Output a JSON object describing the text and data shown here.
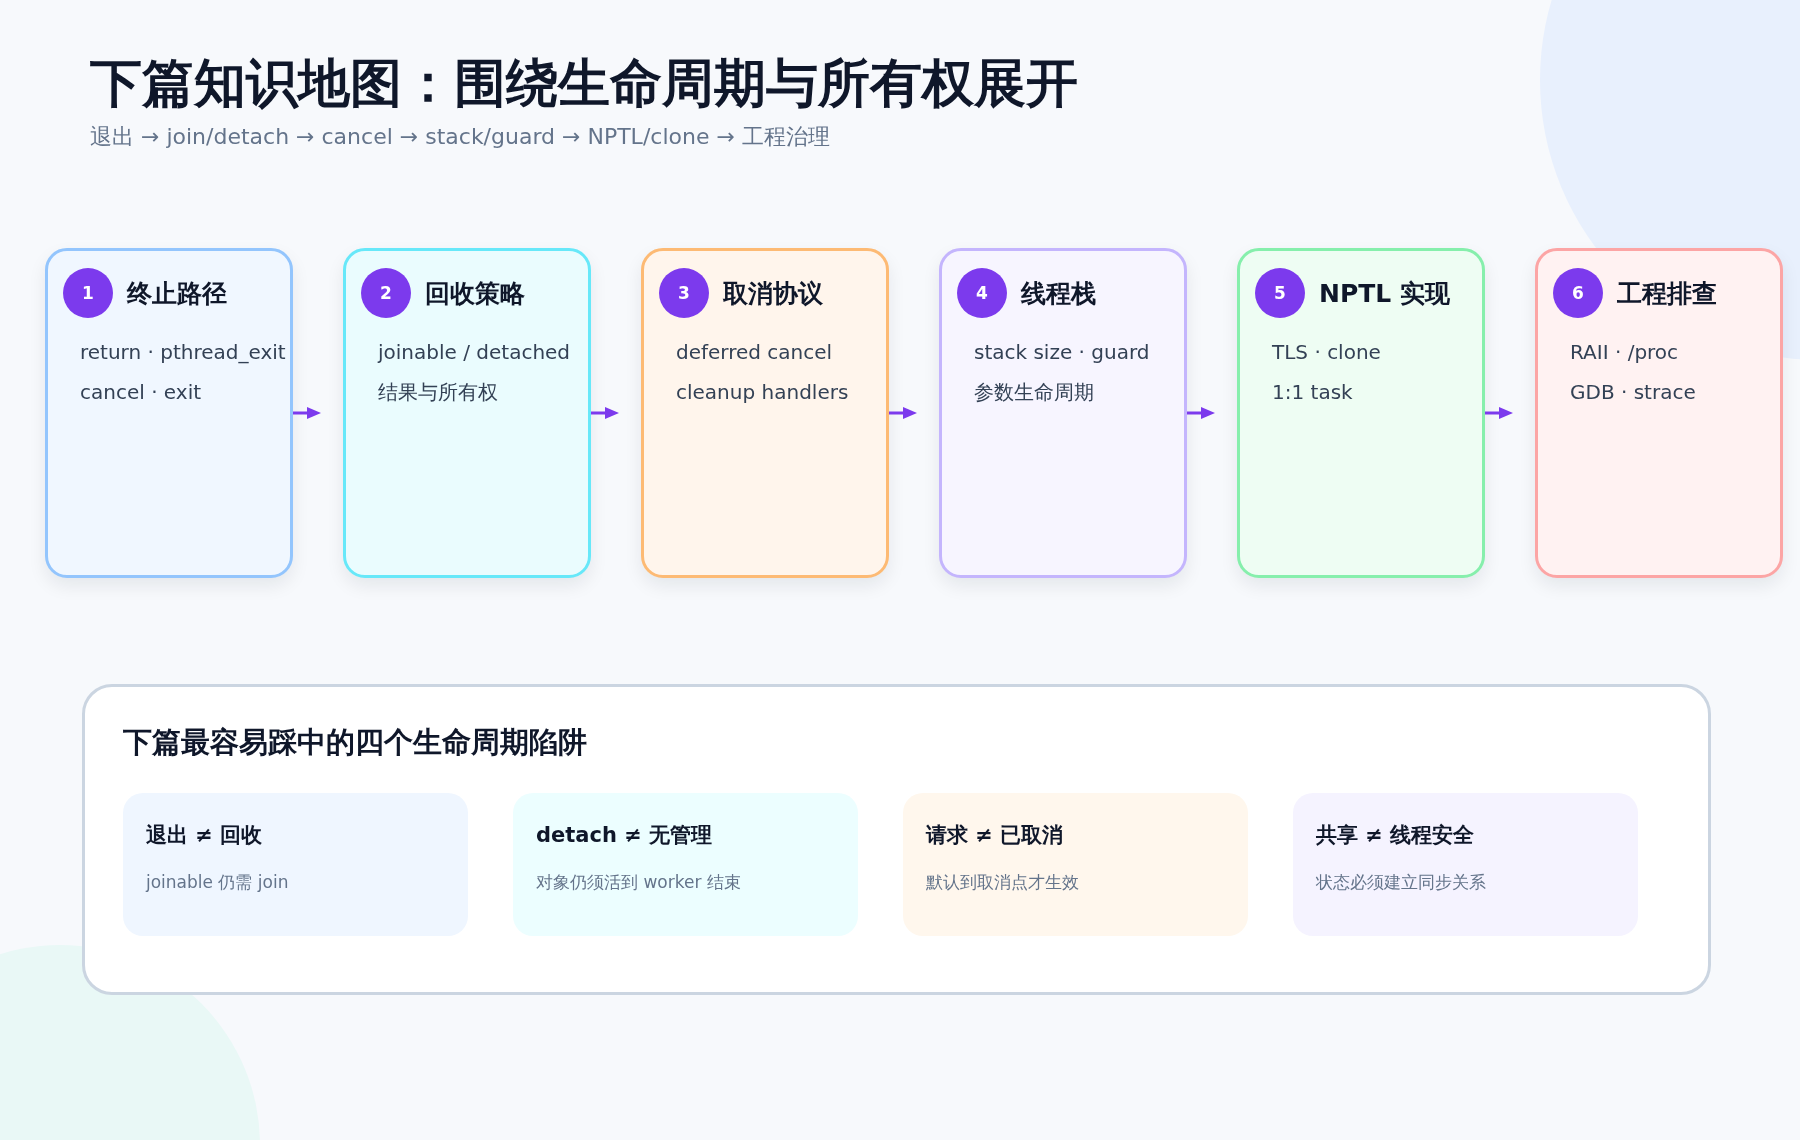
{
  "header": {
    "title": "下篇知识地图：围绕生命周期与所有权展开",
    "subtitle": "退出 → join/detach → cancel → stack/guard → NPTL/clone → 工程治理"
  },
  "steps": [
    {
      "number": "1",
      "title": "终止路径",
      "lines": [
        "return · pthread_exit",
        "cancel · exit"
      ],
      "color": "#93c5fd"
    },
    {
      "number": "2",
      "title": "回收策略",
      "lines": [
        "joinable / detached",
        "结果与所有权"
      ],
      "color": "#67e8f9"
    },
    {
      "number": "3",
      "title": "取消协议",
      "lines": [
        "deferred cancel",
        "cleanup handlers"
      ],
      "color": "#fdba74"
    },
    {
      "number": "4",
      "title": "线程栈",
      "lines": [
        "stack size · guard",
        "参数生命周期"
      ],
      "color": "#c4b5fd"
    },
    {
      "number": "5",
      "title": "NPTL 实现",
      "lines": [
        "TLS · clone",
        "1:1 task"
      ],
      "color": "#86efac"
    },
    {
      "number": "6",
      "title": "工程排查",
      "lines": [
        "RAII · /proc",
        "GDB · strace"
      ],
      "color": "#fca5a5"
    }
  ],
  "pitfalls": {
    "title": "下篇最容易踩中的四个生命周期陷阱",
    "items": [
      {
        "title": "退出 ≠ 回收",
        "note": "joinable 仍需 join",
        "color": "#eff6ff"
      },
      {
        "title": "detach ≠ 无管理",
        "note": "对象仍须活到 worker 结束",
        "color": "#ecfeff"
      },
      {
        "title": "请求 ≠ 已取消",
        "note": "默认到取消点才生效",
        "color": "#fff7ed"
      },
      {
        "title": "共享 ≠ 线程安全",
        "note": "状态必须建立同步关系",
        "color": "#f5f3ff"
      }
    ]
  }
}
